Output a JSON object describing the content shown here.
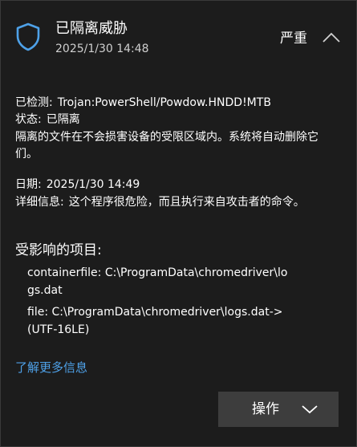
{
  "notification": {
    "title": "已隔离威胁",
    "timestamp": "2025/1/30 14:48",
    "severity": "严重",
    "accent_color": "#4ea1e8",
    "shield_icon": "shield-icon",
    "collapse_icon": "chevron-up-icon"
  },
  "details": {
    "detected_label": "已检测:",
    "detected_value": "Trojan:PowerShell/Powdow.HNDD!MTB",
    "status_label": "状态:",
    "status_value": "已隔离",
    "description": "隔离的文件在不会损害设备的受限区域内。系统将自动删除它们。",
    "date_label": "日期:",
    "date_value": "2025/1/30 14:49",
    "info_label": "详细信息:",
    "info_value": "这个程序很危险，而且执行来自攻击者的命令。"
  },
  "affected": {
    "heading": "受影响的项目:",
    "items": [
      "containerfile: C:\\ProgramData\\chromedriver\\logs.dat",
      "file: C:\\ProgramData\\chromedriver\\logs.dat->(UTF-16LE)"
    ]
  },
  "learn_more": "了解更多信息",
  "action": {
    "label": "操作",
    "icon": "chevron-down-icon"
  }
}
